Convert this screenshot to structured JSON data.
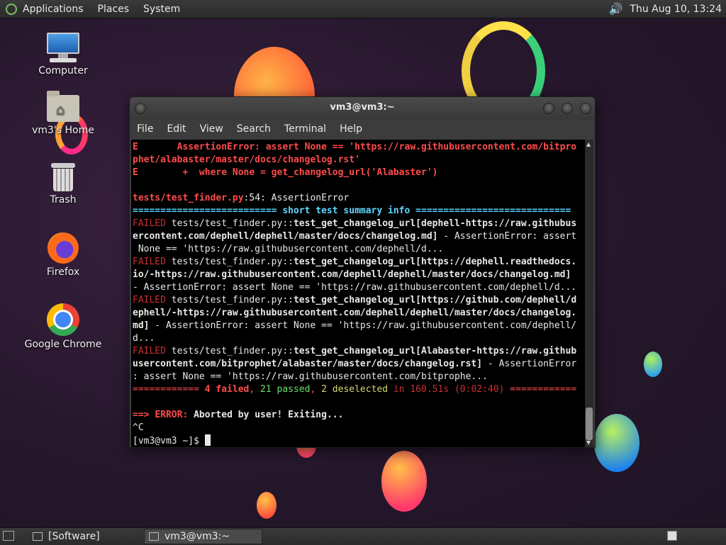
{
  "top_panel": {
    "menus": [
      "Applications",
      "Places",
      "System"
    ],
    "clock": "Thu Aug 10, 13:24"
  },
  "desktop": {
    "icons": [
      {
        "label": "Computer",
        "icon": "computer-icon"
      },
      {
        "label": "vm3's Home",
        "icon": "home-folder-icon"
      },
      {
        "label": "Trash",
        "icon": "trash-icon"
      },
      {
        "label": "Firefox",
        "icon": "firefox-icon"
      },
      {
        "label": "Google Chrome",
        "icon": "chrome-icon"
      }
    ]
  },
  "window": {
    "title": "vm3@vm3:~",
    "menu": [
      "File",
      "Edit",
      "View",
      "Search",
      "Terminal",
      "Help"
    ]
  },
  "terminal": {
    "l1a": "E       AssertionError: assert None == 'https://raw.githubusercontent.com/bitpro",
    "l1b": "phet/alabaster/master/docs/changelog.rst'",
    "l2": "E        +  where None = get_changelog_url('Alabaster')",
    "l3_file": "tests/test_finder.py",
    "l3_rest": ":54: AssertionError",
    "summary": "========================== short test summary info ============================",
    "failed_label": "FAILED",
    "f1a_pre": " tests/test_finder.py::",
    "f1a_bold": "test_get_changelog_url[dephell-https://raw.githubus",
    "f1b_bold": "ercontent.com/dephell/dephell/master/docs/changelog.md]",
    "f1b_rest": " - AssertionError: assert",
    "f1c": " None == 'https://raw.githubusercontent.com/dephell/d...",
    "f2a_pre": " tests/test_finder.py::",
    "f2a_bold": "test_get_changelog_url[https://dephell.readthedocs.",
    "f2b_bold": "io/-https://raw.githubusercontent.com/dephell/dephell/master/docs/changelog.md]",
    "f2c": "- AssertionError: assert None == 'https://raw.githubusercontent.com/dephell/d...",
    "f3a_pre": " tests/test_finder.py::",
    "f3a_bold": "test_get_changelog_url[https://github.com/dephell/d",
    "f3b_bold": "ephell/-https://raw.githubusercontent.com/dephell/dephell/master/docs/changelog.",
    "f3c_bold": "md]",
    "f3c_rest": " - AssertionError: assert None == 'https://raw.githubusercontent.com/dephell/",
    "f3d": "d...",
    "f4a_pre": " tests/test_finder.py::",
    "f4a_bold": "test_get_changelog_url[Alabaster-https://raw.github",
    "f4b_bold": "usercontent.com/bitprophet/alabaster/master/docs/changelog.rst]",
    "f4b_rest": " - AssertionError",
    "f4c": ": assert None == 'https://raw.githubusercontent.com/bitprophe...",
    "res_pre": "============ ",
    "res_failed": "4 failed",
    "res_sep1": ", ",
    "res_passed": "21 passed",
    "res_sep2": ", ",
    "res_desel": "2 deselected",
    "res_time": " in 160.51s (0:02:40) ",
    "res_post": "============",
    "err_arrow": "==> ",
    "err_label": "ERROR:",
    "err_msg": " Aborted by user! Exiting...",
    "ctrlc": "^C",
    "prompt": "[vm3@vm3 ~]$ "
  },
  "bottom_panel": {
    "tasks": [
      "[Software]",
      "vm3@vm3:~"
    ]
  }
}
